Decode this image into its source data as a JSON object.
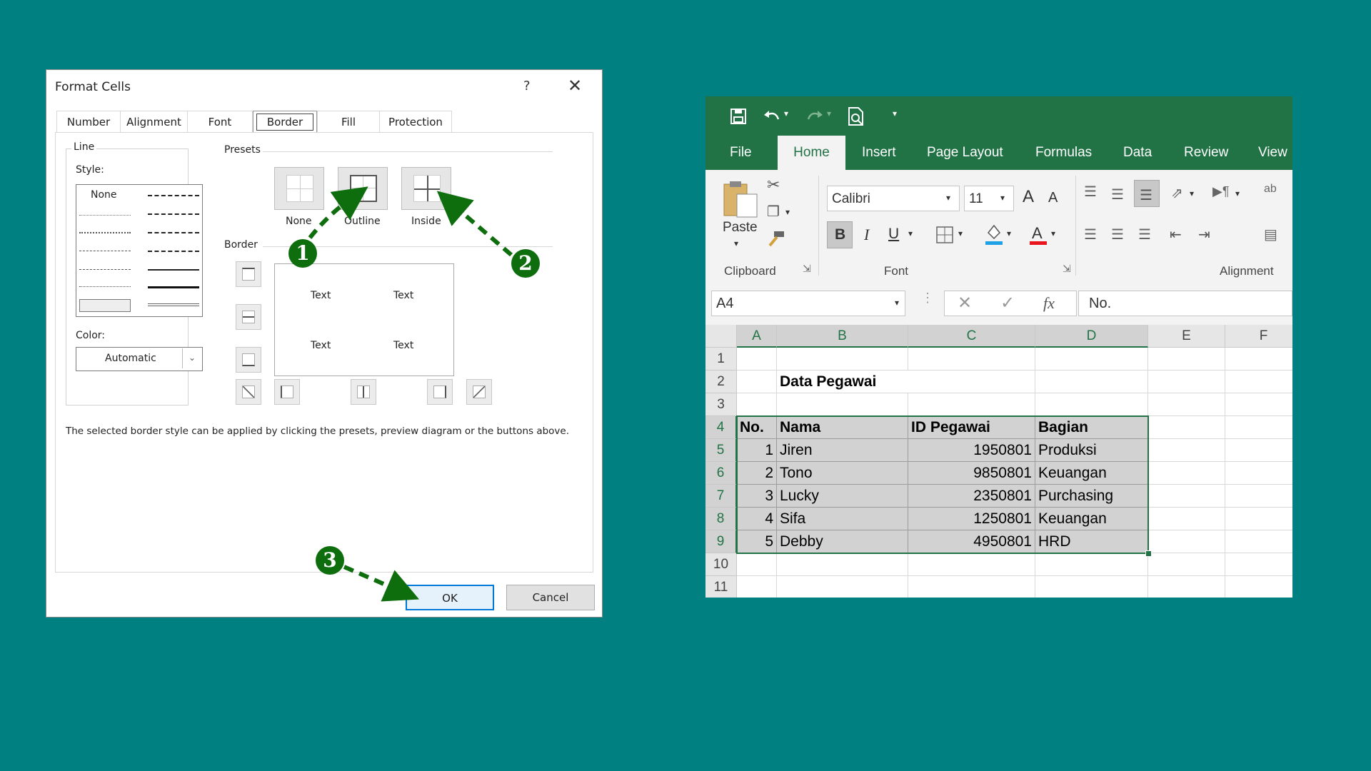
{
  "dialog": {
    "title": "Format Cells",
    "help": "?",
    "close": "✕",
    "tabs": [
      "Number",
      "Alignment",
      "Font",
      "Border",
      "Fill",
      "Protection"
    ],
    "line_label": "Line",
    "style_label": "Style:",
    "style_none": "None",
    "color_label": "Color:",
    "color_value": "Automatic",
    "presets_label": "Presets",
    "presets": [
      "None",
      "Outline",
      "Inside"
    ],
    "border_label": "Border",
    "preview_texts": [
      "Text",
      "Text",
      "Text",
      "Text"
    ],
    "hint": "The selected border style can be applied by clicking the presets, preview diagram or the buttons above.",
    "ok": "OK",
    "cancel": "Cancel",
    "badges": [
      "1",
      "2",
      "3"
    ],
    "badge_color": "#0e6e0e"
  },
  "excel": {
    "accent": "#217346",
    "ribbon_tabs": [
      "File",
      "Home",
      "Insert",
      "Page Layout",
      "Formulas",
      "Data",
      "Review",
      "View"
    ],
    "active_tab": "Home",
    "clipboard": {
      "paste": "Paste",
      "label": "Clipboard"
    },
    "font": {
      "name": "Calibri",
      "size": "11",
      "label": "Font",
      "bold": "B",
      "italic": "I",
      "underline": "U",
      "grow": "A",
      "shrink": "A"
    },
    "alignment_label": "Alignment",
    "name_box": "A4",
    "formula": "No.",
    "fx": "fx",
    "columns": [
      "A",
      "B",
      "C",
      "D",
      "E",
      "F"
    ],
    "rows": [
      "1",
      "2",
      "3",
      "4",
      "5",
      "6",
      "7",
      "8",
      "9",
      "10",
      "11"
    ],
    "title_cell": "Data Pegawai",
    "headers": [
      "No.",
      "Nama",
      "ID Pegawai",
      "Bagian"
    ],
    "data": [
      [
        "1",
        "Jiren",
        "1950801",
        "Produksi"
      ],
      [
        "2",
        "Tono",
        "9850801",
        "Keuangan"
      ],
      [
        "3",
        "Lucky",
        "2350801",
        "Purchasing"
      ],
      [
        "4",
        "Sifa",
        "1250801",
        "Keuangan"
      ],
      [
        "5",
        "Debby",
        "4950801",
        "HRD"
      ]
    ]
  }
}
